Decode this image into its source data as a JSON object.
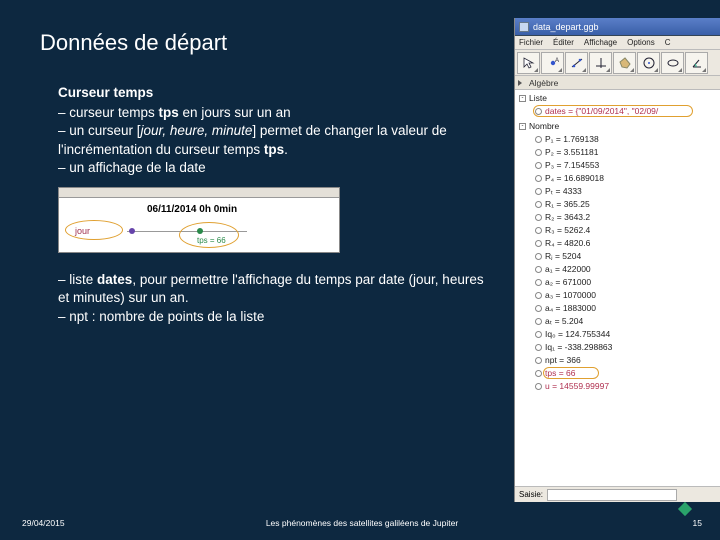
{
  "slide": {
    "title": "Données de départ",
    "block1": {
      "heading": "Curseur temps",
      "l1a": "– curseur temps ",
      "l1b": "tps",
      "l1c": " en jours sur un an",
      "l2a": "– un curseur [",
      "l2b": "jour, heure, minute",
      "l2c": "] permet de changer la valeur de l'incrémentation du curseur temps ",
      "l2d": "tps",
      "l2e": ".",
      "l3": "– un affichage de la date"
    },
    "cursor_img": {
      "date_text": "06/11/2014  0h 0min",
      "jour_label": "jour",
      "tps_label": "tps = 66"
    },
    "block2": {
      "l1a": "– liste ",
      "l1b": "dates",
      "l1c": ", pour permettre l'affichage du temps par date (jour, heures et minutes) sur un an.",
      "l2": "– npt : nombre de points de la liste"
    }
  },
  "footer": {
    "date": "29/04/2015",
    "title": "Les phénomènes des satellites galiléens de Jupiter",
    "page": "15"
  },
  "geogebra": {
    "window_title": "data_depart.ggb",
    "menu": {
      "m1": "Fichier",
      "m2": "Éditer",
      "m3": "Affichage",
      "m4": "Options",
      "m5": "C"
    },
    "algebra_label": "Algèbre",
    "g_liste": "Liste",
    "dates_item": "dates = {\"01/09/2014\", \"02/09/",
    "g_nombre": "Nombre",
    "items": {
      "p1": "P₁ = 1.769138",
      "p2": "P₂ = 3.551181",
      "p3": "P₃ = 7.154553",
      "p4": "P₄ = 16.689018",
      "pt": "Pₜ = 4333",
      "r1": "R₁ = 365.25",
      "r2": "R₂ = 3643.2",
      "r3": "R₃ = 5262.4",
      "r4": "R₄ = 4820.6",
      "rj": "Rⱼ = 5204",
      "a1": "a₁ = 422000",
      "a2": "a₂ = 671000",
      "a3": "a₃ = 1070000",
      "a4": "a₄ = 1883000",
      "at": "aₜ = 5.204",
      "iq0": "Iq₀ = 124.755344",
      "iq1": "Iq₁ = -338.298863",
      "npt": "npt = 366",
      "tps": "tps = 66",
      "last": "u = 14559.99997"
    },
    "saisie_label": "Saisie:"
  }
}
